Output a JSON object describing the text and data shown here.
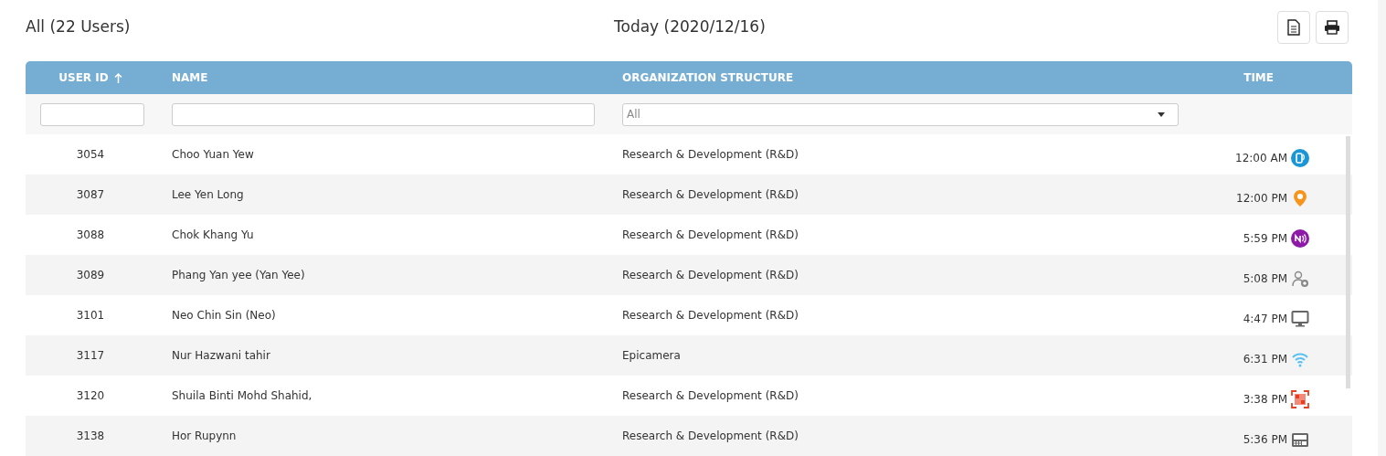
{
  "header": {
    "title": "All (22 Users)",
    "date": "Today (2020/12/16)"
  },
  "toolbar": [
    {
      "kind": "document"
    },
    {
      "kind": "print"
    }
  ],
  "table": {
    "columns": [
      {
        "label": "USER ID",
        "sorted": true
      },
      {
        "label": "NAME",
        "sorted": false
      },
      {
        "label": "ORGANIZATION STRUCTURE",
        "sorted": false
      },
      {
        "label": "TIME",
        "sorted": false
      }
    ],
    "filters": [
      {
        "kind": "text"
      },
      {
        "kind": "text"
      },
      {
        "kind": "select",
        "value": "All"
      }
    ],
    "rows": [
      {
        "user_id": "3054",
        "name": "Choo Yuan Yew",
        "organization": "Research & Development (R&D)",
        "time": "12:00 AM",
        "kind": "app"
      },
      {
        "user_id": "3087",
        "name": "Lee Yen Long",
        "organization": "Research & Development (R&D)",
        "time": "12:00 PM",
        "kind": "location"
      },
      {
        "user_id": "3088",
        "name": "Chok Khang Yu",
        "organization": "Research & Development (R&D)",
        "time": "5:59 PM",
        "kind": "nfc"
      },
      {
        "user_id": "3089",
        "name": "Phang Yan yee (Yan Yee)",
        "organization": "Research & Development (R&D)",
        "time": "5:08 PM",
        "kind": "user"
      },
      {
        "user_id": "3101",
        "name": "Neo Chin Sin (Neo)",
        "organization": "Research & Development (R&D)",
        "time": "4:47 PM",
        "kind": "desktop"
      },
      {
        "user_id": "3117",
        "name": "Nur Hazwani tahir",
        "organization": "Epicamera",
        "time": "6:31 PM",
        "kind": "wifi"
      },
      {
        "user_id": "3120",
        "name": "Shuila Binti Mohd Shahid,",
        "organization": "Research & Development (R&D)",
        "time": "3:38 PM",
        "kind": "qr"
      },
      {
        "user_id": "3138",
        "name": "Hor Rupynn",
        "organization": "Research & Development (R&D)",
        "time": "5:36 PM",
        "kind": "terminal"
      }
    ]
  }
}
